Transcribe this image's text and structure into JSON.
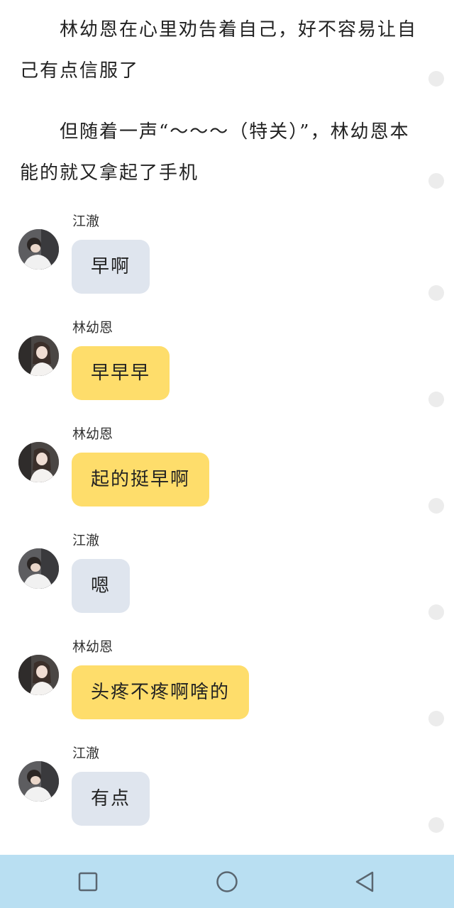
{
  "story": {
    "paragraphs": [
      "林幼恩在心里劝告着自己，好不容易让自己有点信服了",
      "但随着一声“～～～（特关）”，林幼恩本能的就又拿起了手机"
    ]
  },
  "chat": {
    "messages": [
      {
        "sender": "江澈",
        "text": "早啊",
        "side": "other",
        "avatar": "jiangche-avatar"
      },
      {
        "sender": "林幼恩",
        "text": "早早早",
        "side": "self",
        "avatar": "linyouen-avatar"
      },
      {
        "sender": "林幼恩",
        "text": "起的挺早啊",
        "side": "self",
        "avatar": "linyouen-avatar"
      },
      {
        "sender": "江澈",
        "text": "嗯",
        "side": "other",
        "avatar": "jiangche-avatar"
      },
      {
        "sender": "林幼恩",
        "text": "头疼不疼啊啥的",
        "side": "self",
        "avatar": "linyouen-avatar"
      },
      {
        "sender": "江澈",
        "text": "有点",
        "side": "other",
        "avatar": "jiangche-avatar"
      }
    ]
  },
  "navbar": {
    "icons": [
      "square-recents-icon",
      "circle-home-icon",
      "triangle-back-icon"
    ],
    "background": "#b9dff2"
  },
  "colors": {
    "other_bubble": "#dfe5ee",
    "self_bubble": "#fedd6b"
  }
}
